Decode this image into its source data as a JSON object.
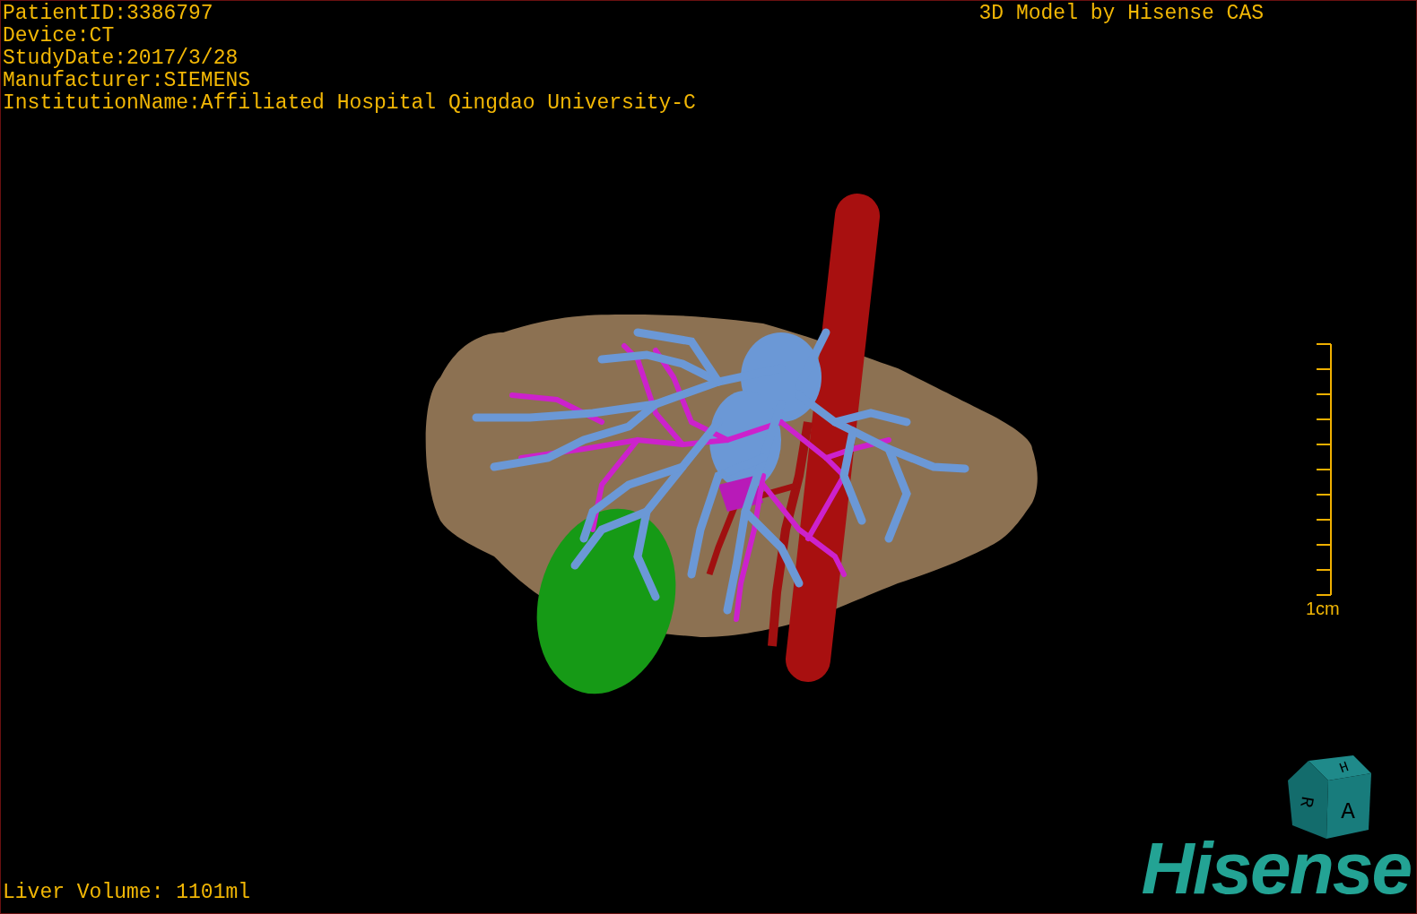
{
  "patient_info": [
    "PatientID:3386797",
    "Device:CT",
    "StudyDate:2017/3/28",
    "Manufacturer:SIEMENS",
    "InstitutionName:Affiliated Hospital Qingdao University-C"
  ],
  "title": "3D Model by Hisense CAS",
  "scale_bar": {
    "label": "1cm"
  },
  "liver_volume": "Liver Volume: 1101ml",
  "orientation_cube": {
    "labels": [
      "H",
      "R",
      "A"
    ]
  },
  "brand_logo": "Hisense"
}
